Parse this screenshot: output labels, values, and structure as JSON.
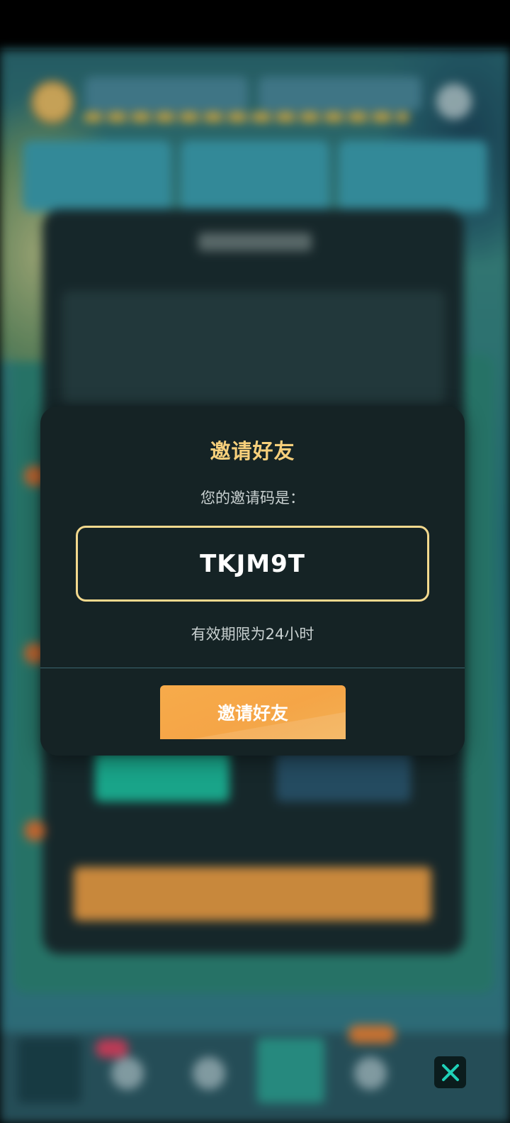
{
  "dialog": {
    "title": "邀请好友",
    "subtitle": "您的邀请码是：",
    "invite_code": "TKJM9T",
    "validity": "有效期限为24小时",
    "invite_button_label": "邀请好友"
  },
  "icons": {
    "close": "close-icon"
  },
  "colors": {
    "title_gold": "#f6cf7b",
    "code_border": "#f3d98e",
    "modal_bg": "#152325",
    "button_orange": "#f5a547",
    "close_accent": "#1fd1b8"
  }
}
